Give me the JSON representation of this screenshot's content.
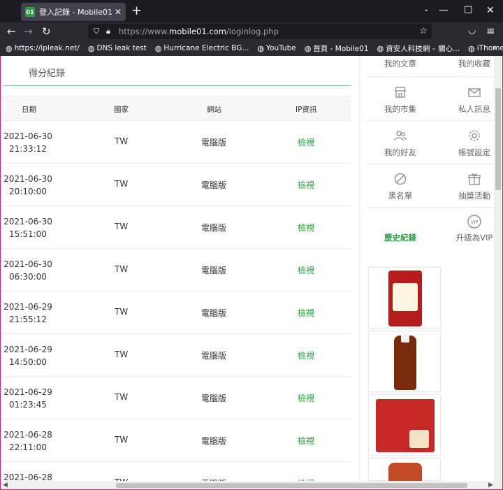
{
  "browser": {
    "tab_title": "登入記錄 - Mobile01",
    "tab_favicon_text": "01",
    "url_prefix": "https://www.",
    "url_domain": "mobile01.com",
    "url_path": "/loginlog.php",
    "bookmarks": [
      "https://ipleak.net/",
      "DNS leak test",
      "Hurricane Electric BG...",
      "YouTube",
      "首頁 - Mobile01",
      "資安人科技網 – 關心...",
      "iThome | iThome Onl..."
    ]
  },
  "page": {
    "section_title": "得分紀錄",
    "columns": [
      "日期",
      "國家",
      "網站",
      "IP資訊"
    ],
    "rows": [
      {
        "date": "2021-06-30",
        "time": "21:33:12",
        "country": "TW",
        "site": "電腦版",
        "ip": "檢視"
      },
      {
        "date": "2021-06-30",
        "time": "20:10:00",
        "country": "TW",
        "site": "電腦版",
        "ip": "檢視"
      },
      {
        "date": "2021-06-30",
        "time": "15:51:00",
        "country": "TW",
        "site": "電腦版",
        "ip": "檢視"
      },
      {
        "date": "2021-06-30",
        "time": "06:30:00",
        "country": "TW",
        "site": "電腦版",
        "ip": "檢視"
      },
      {
        "date": "2021-06-29",
        "time": "21:55:12",
        "country": "TW",
        "site": "電腦版",
        "ip": "檢視"
      },
      {
        "date": "2021-06-29",
        "time": "14:50:00",
        "country": "TW",
        "site": "電腦版",
        "ip": "檢視"
      },
      {
        "date": "2021-06-29",
        "time": "01:23:45",
        "country": "TW",
        "site": "電腦版",
        "ip": "檢視"
      },
      {
        "date": "2021-06-28",
        "time": "22:11:00",
        "country": "TW",
        "site": "電腦版",
        "ip": "檢視"
      },
      {
        "date": "2021-06-28",
        "time": "",
        "country": "TW",
        "site": "電腦版",
        "ip": "檢視"
      }
    ]
  },
  "sidebar": {
    "items": [
      {
        "label": "我的文章",
        "icon": "article-icon"
      },
      {
        "label": "我的收藏",
        "icon": "bookmark-icon"
      },
      {
        "label": "我的市集",
        "icon": "store-icon"
      },
      {
        "label": "私人訊息",
        "icon": "mail-icon"
      },
      {
        "label": "我的好友",
        "icon": "friends-icon"
      },
      {
        "label": "帳號設定",
        "icon": "gear-icon"
      },
      {
        "label": "黑名單",
        "icon": "block-icon"
      },
      {
        "label": "抽獎活動",
        "icon": "gift-icon"
      },
      {
        "label": "歷史紀錄",
        "icon": ""
      },
      {
        "label": "升級為VIP",
        "icon": "vip-icon"
      }
    ],
    "vip_badge": "VIP"
  },
  "colors": {
    "accent_green": "#2ea043",
    "chrome_dark": "#1c1b22",
    "chrome_toolbar": "#2b2a33"
  }
}
